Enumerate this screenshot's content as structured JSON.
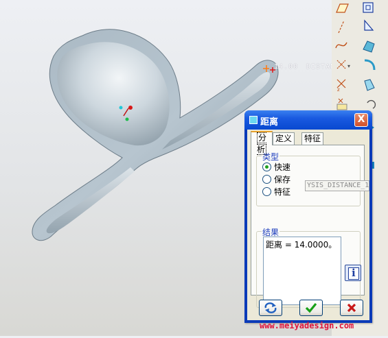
{
  "viewport": {
    "dimension_value": "14.00",
    "dimension_name": "DISTANC"
  },
  "toolbar": {
    "icons": [
      "parallelogram-plane-icon",
      "datum-plane-icon",
      "axis-line-icon",
      "datum-plane-corner-icon",
      "curve-icon",
      "datum-surface-icon",
      "point-cross-icon",
      "fillet-icon",
      "point-array-icon",
      "edge-icon",
      "point-offset-icon",
      "rotate-icon",
      "point-icon",
      "box-icon"
    ]
  },
  "dialog": {
    "title": "距离",
    "close_label": "X",
    "tabs": [
      "分析",
      "定义",
      "特征"
    ],
    "type_group_label": "类型",
    "radio_options": [
      {
        "label": "快速",
        "selected": true
      },
      {
        "label": "保存",
        "selected": false
      },
      {
        "label": "特征",
        "selected": false
      }
    ],
    "name_field_value": "YSIS_DISTANCE_1",
    "result_group_label": "结果",
    "result_text": "距离 = 14.0000。",
    "info_glyph": "i"
  },
  "watermark": "www.meiyadesign.com"
}
